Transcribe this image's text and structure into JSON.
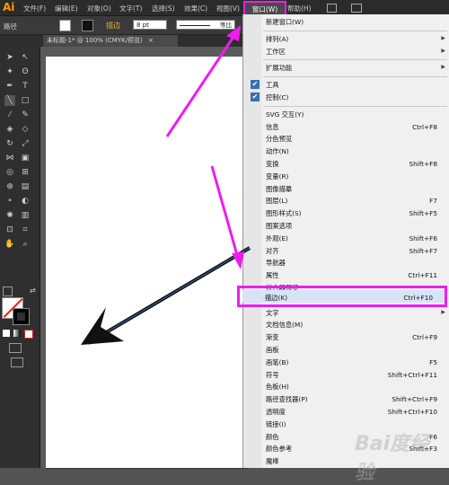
{
  "app": {
    "logo": "Ai"
  },
  "menubar": {
    "items": [
      "文件(F)",
      "编辑(E)",
      "对象(O)",
      "文字(T)",
      "选择(S)",
      "效果(C)",
      "视图(V)"
    ],
    "active": "窗口(W)",
    "after": "帮助(H)"
  },
  "controlbar": {
    "path_label": "路径",
    "stroke_label": "描边",
    "stroke_weight": "8 pt",
    "stroke_profile": "等比"
  },
  "document_tab": {
    "title": "未标题-1* @ 100% (CMYK/预览)",
    "close": "×"
  },
  "window_menu": {
    "items": [
      {
        "label": "新建窗口(W)"
      },
      {
        "sep": true
      },
      {
        "label": "排列(A)",
        "submenu": true
      },
      {
        "label": "工作区",
        "submenu": true
      },
      {
        "sep": true
      },
      {
        "label": "扩展功能",
        "submenu": true
      },
      {
        "sep": true
      },
      {
        "label": "工具",
        "checked": true
      },
      {
        "label": "控制(C)",
        "checked": true
      },
      {
        "sep": true
      },
      {
        "label": "SVG 交互(Y)"
      },
      {
        "label": "信息",
        "shortcut": "Ctrl+F8"
      },
      {
        "label": "分色预览"
      },
      {
        "label": "动作(N)"
      },
      {
        "label": "变换",
        "shortcut": "Shift+F8"
      },
      {
        "label": "变量(R)"
      },
      {
        "label": "图像描摹"
      },
      {
        "label": "图层(L)",
        "shortcut": "F7"
      },
      {
        "label": "图形样式(S)",
        "shortcut": "Shift+F5"
      },
      {
        "label": "图案选项"
      },
      {
        "label": "外观(E)",
        "shortcut": "Shift+F6"
      },
      {
        "label": "对齐",
        "shortcut": "Shift+F7"
      },
      {
        "label": "导航器"
      },
      {
        "label": "属性",
        "shortcut": "Ctrl+F11"
      },
      {
        "label": "拼合器预览"
      },
      {
        "label": "描边(K)",
        "shortcut": "Ctrl+F10",
        "highlighted": true
      },
      {
        "label": "文字",
        "submenu": true
      },
      {
        "label": "文档信息(M)"
      },
      {
        "label": "渐变",
        "shortcut": "Ctrl+F9"
      },
      {
        "label": "画板"
      },
      {
        "label": "画笔(B)",
        "shortcut": "F5"
      },
      {
        "label": "符号",
        "shortcut": "Shift+Ctrl+F11"
      },
      {
        "label": "色板(H)"
      },
      {
        "label": "路径查找器(P)",
        "shortcut": "Shift+Ctrl+F9"
      },
      {
        "label": "透明度",
        "shortcut": "Shift+Ctrl+F10"
      },
      {
        "label": "链接(I)"
      },
      {
        "label": "颜色",
        "shortcut": "F6"
      },
      {
        "label": "颜色参考",
        "shortcut": "Shift+F3"
      },
      {
        "label": "魔棒"
      }
    ]
  },
  "watermark": "Bai度经验",
  "colors": {
    "highlight": "#ee1dee",
    "menubar": "#2b2b2b",
    "accent": "#ff9a00"
  }
}
